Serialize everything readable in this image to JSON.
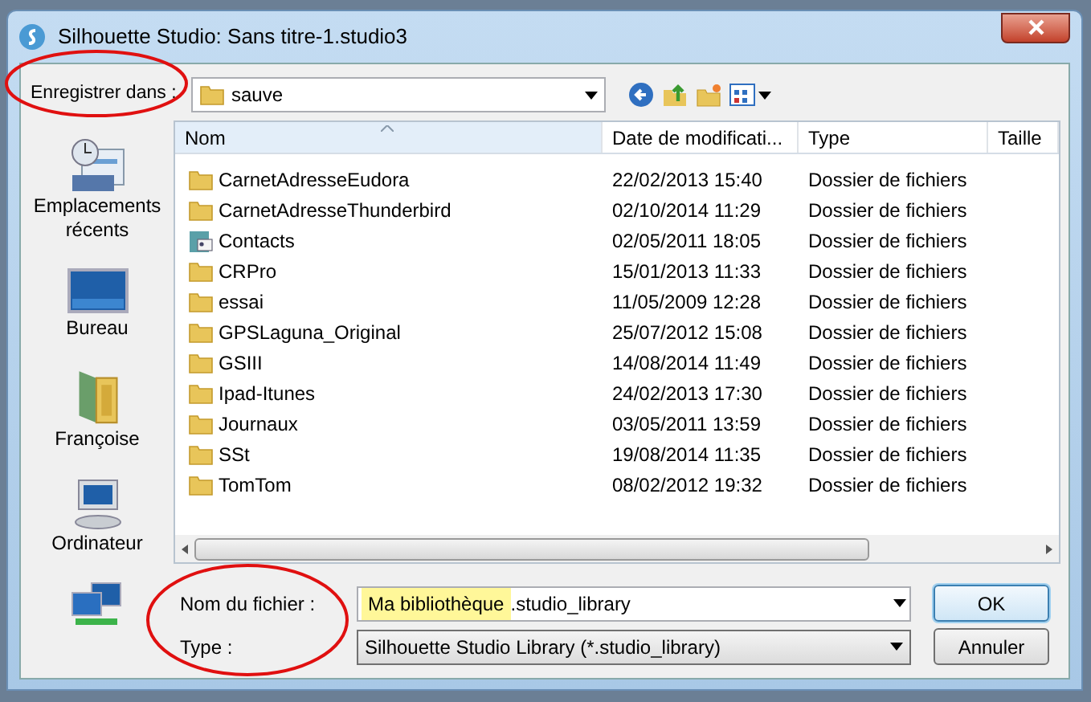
{
  "window": {
    "title": "Silhouette Studio: Sans titre-1.studio3"
  },
  "save_in": {
    "label": "Enregistrer dans :",
    "value": "sauve"
  },
  "places": [
    {
      "kind": "recent",
      "label": "Emplacements récents"
    },
    {
      "kind": "desktop",
      "label": "Bureau"
    },
    {
      "kind": "user",
      "label": "Françoise"
    },
    {
      "kind": "computer",
      "label": "Ordinateur"
    },
    {
      "kind": "network"
    }
  ],
  "table": {
    "columns": [
      "Nom",
      "Date de modificati...",
      "Type",
      "Taille"
    ],
    "rows": [
      {
        "kind": "folder",
        "name": "CarnetAdresseEudora",
        "date": "22/02/2013 15:40",
        "type": "Dossier de fichiers"
      },
      {
        "kind": "folder",
        "name": "CarnetAdresseThunderbird",
        "date": "02/10/2014 11:29",
        "type": "Dossier de fichiers"
      },
      {
        "kind": "contacts",
        "name": "Contacts",
        "date": "02/05/2011 18:05",
        "type": "Dossier de fichiers"
      },
      {
        "kind": "folder",
        "name": "CRPro",
        "date": "15/01/2013 11:33",
        "type": "Dossier de fichiers"
      },
      {
        "kind": "folder",
        "name": "essai",
        "date": "11/05/2009 12:28",
        "type": "Dossier de fichiers"
      },
      {
        "kind": "folder",
        "name": "GPSLaguna_Original",
        "date": "25/07/2012 15:08",
        "type": "Dossier de fichiers"
      },
      {
        "kind": "folder",
        "name": "GSIII",
        "date": "14/08/2014 11:49",
        "type": "Dossier de fichiers"
      },
      {
        "kind": "folder",
        "name": "Ipad-Itunes",
        "date": "24/02/2013 17:30",
        "type": "Dossier de fichiers"
      },
      {
        "kind": "folder",
        "name": "Journaux",
        "date": "03/05/2011 13:59",
        "type": "Dossier de fichiers"
      },
      {
        "kind": "folder",
        "name": "SSt",
        "date": "19/08/2014 11:35",
        "type": "Dossier de fichiers"
      },
      {
        "kind": "folder",
        "name": "TomTom",
        "date": "08/02/2012 19:32",
        "type": "Dossier de fichiers"
      }
    ]
  },
  "file_name": {
    "label": "Nom du fichier :",
    "value_highlighted": "Ma bibliothèque",
    "value_rest": ".studio_library"
  },
  "file_type": {
    "label": "Type :",
    "value": "Silhouette Studio Library (*.studio_library)"
  },
  "buttons": [
    {
      "label": "OK",
      "default": true
    },
    {
      "label": "Annuler",
      "default": false
    }
  ]
}
